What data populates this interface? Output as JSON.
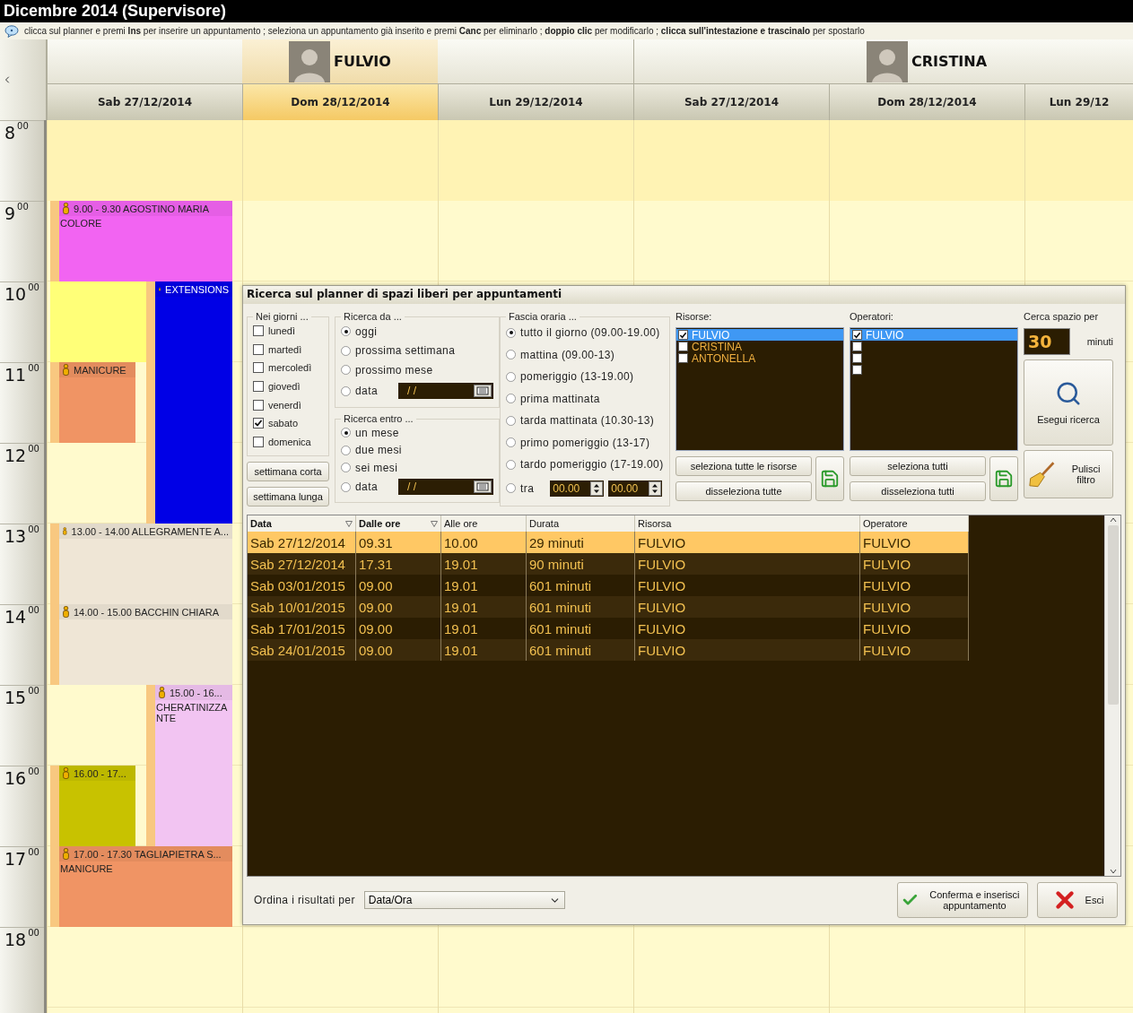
{
  "window": {
    "title": "Dicembre 2014 (Supervisore)"
  },
  "hint": "clicca sul planner e premi **Ins** per inserire un appuntamento ; seleziona un appuntamento già inserito e premi **Canc** per eliminarlo ; **doppio clic** per modificarlo ; **clicca sull'intestazione e trascinalo** per spostarlo",
  "hours": [
    "8$^{00}$",
    "9$^{00}$",
    "10$^{00}$",
    "11$^{00}$",
    "12$^{00}$",
    "13$^{00}$",
    "14$^{00}$",
    "15$^{00}$",
    "16$^{00}$",
    "17$^{00}$",
    "18$^{00}$"
  ],
  "resources": [
    {
      "name": "FULVIO",
      "days": [
        {
          "label": "Sab 27/12/2014",
          "selected": false,
          "appointments": [
            {
              "kind": "appointment",
              "header": "9.00 - 9.30 AGOSTINO  MARIA",
              "body": "COLORE",
              "color": "#f264f2"
            },
            {
              "kind": "highlight",
              "color": "#ffff78"
            },
            {
              "kind": "appointment",
              "header": "EXTENSIONS",
              "color": "#0000e6"
            },
            {
              "kind": "appointment",
              "header": "MANICURE",
              "color": "#f09464"
            },
            {
              "kind": "appointment",
              "header": "13.00 - 14.00 ALLEGRAMENTE  A...",
              "color": "#efe6d6"
            },
            {
              "kind": "appointment",
              "header": "14.00 - 15.00 BACCHIN  CHIARA",
              "color": "#efe6d6"
            },
            {
              "kind": "appointment",
              "header": "15.00 - 16...",
              "body": "CHERATINIZZANTE",
              "color": "#f2c4f2"
            },
            {
              "kind": "appointment",
              "header": "16.00 - 17...",
              "color": "#c8c200"
            },
            {
              "kind": "appointment",
              "header": "17.00 - 17.30 TAGLIAPIETRA  S...",
              "body": "MANICURE",
              "color": "#f09464"
            }
          ]
        },
        {
          "label": "Dom 28/12/2014",
          "selected": true
        },
        {
          "label": "Lun 29/12/2014",
          "selected": false
        }
      ]
    },
    {
      "name": "CRISTINA",
      "days": [
        {
          "label": "Sab 27/12/2014",
          "selected": false
        },
        {
          "label": "Dom 28/12/2014",
          "selected": false
        },
        {
          "label": "Lun 29/12",
          "selected": false
        }
      ]
    }
  ],
  "search_dialog": {
    "title": "Ricerca sul planner di spazi liberi per appuntamenti",
    "days": {
      "legend": "Nei giorni ...",
      "options": [
        {
          "label": "lunedì",
          "checked": false
        },
        {
          "label": "martedì",
          "checked": false
        },
        {
          "label": "mercoledì",
          "checked": false
        },
        {
          "label": "giovedì",
          "checked": false
        },
        {
          "label": "venerdì",
          "checked": false
        },
        {
          "label": "sabato",
          "checked": true
        },
        {
          "label": "domenica",
          "checked": false
        }
      ]
    },
    "days_buttons": [
      "settimana corta",
      "settimana lunga"
    ],
    "search_from": {
      "legend": "Ricerca da ...",
      "options": [
        {
          "kind": "radio",
          "label": "oggi",
          "selected": true
        },
        {
          "kind": "radio",
          "label": "prossima settimana",
          "selected": false
        },
        {
          "kind": "radio",
          "label": "prossimo mese",
          "selected": false
        },
        {
          "kind": "date",
          "label": "data",
          "selected": false,
          "value": "/ /"
        }
      ]
    },
    "search_within": {
      "legend": "Ricerca entro ...",
      "options": [
        {
          "kind": "radio",
          "label": "un mese",
          "selected": true
        },
        {
          "kind": "radio",
          "label": "due mesi",
          "selected": false
        },
        {
          "kind": "radio",
          "label": "sei mesi",
          "selected": false
        },
        {
          "kind": "date",
          "label": "data",
          "selected": false,
          "value": "/ /"
        }
      ]
    },
    "time_range": {
      "legend": "Fascia oraria ...",
      "options": [
        {
          "kind": "radio",
          "label": "tutto il giorno (09.00-19.00)",
          "selected": true
        },
        {
          "kind": "radio",
          "label": "mattina (09.00-13)",
          "selected": false
        },
        {
          "kind": "radio",
          "label": "pomeriggio (13-19.00)",
          "selected": false
        },
        {
          "kind": "radio",
          "label": "prima mattinata",
          "selected": false
        },
        {
          "kind": "radio",
          "label": "tarda mattinata (10.30-13)",
          "selected": false
        },
        {
          "kind": "radio",
          "label": "primo pomeriggio (13-17)",
          "selected": false
        },
        {
          "kind": "radio",
          "label": "tardo pomeriggio (17-19.00)",
          "selected": false
        },
        {
          "kind": "range",
          "label": "tra",
          "selected": false,
          "from": "00.00",
          "to": "00.00"
        }
      ]
    },
    "resources": {
      "label": "Risorse:",
      "items": [
        {
          "name": "FULVIO",
          "checked": true,
          "selected": true
        },
        {
          "name": "CRISTINA",
          "checked": false,
          "selected": false
        },
        {
          "name": "ANTONELLA",
          "checked": false,
          "selected": false
        }
      ],
      "buttons": [
        "seleziona tutte le risorse",
        "disseleziona tutte"
      ]
    },
    "operators": {
      "label": "Operatori:",
      "items": [
        {
          "name": "FULVIO",
          "checked": true,
          "selected": true
        },
        {
          "checked": false,
          "selected": false
        },
        {
          "checked": false,
          "selected": false
        },
        {
          "checked": false,
          "selected": false
        }
      ],
      "buttons": [
        "seleziona tutti",
        "disseleziona tutti"
      ]
    },
    "duration": {
      "label": "Cerca spazio per",
      "value": "30",
      "unit": "minuti"
    },
    "search_button": "Esegui ricerca",
    "clear_button": "Pulisci filtro",
    "results": {
      "columns": [
        {
          "label": "Data",
          "sorted": true
        },
        {
          "label": "Dalle ore",
          "sorted": true
        },
        {
          "label": "Alle ore",
          "sorted": false
        },
        {
          "label": "Durata",
          "sorted": false
        },
        {
          "label": "Risorsa",
          "sorted": false
        },
        {
          "label": "Operatore",
          "sorted": false
        }
      ],
      "rows": [
        {
          "cells": [
            "Sab 27/12/2014",
            "09.31",
            "10.00",
            "29 minuti",
            "FULVIO",
            "FULVIO"
          ],
          "selected": true
        },
        {
          "cells": [
            "Sab 27/12/2014",
            "17.31",
            "19.01",
            "90 minuti",
            "FULVIO",
            "FULVIO"
          ],
          "selected": false
        },
        {
          "cells": [
            "Sab 03/01/2015",
            "09.00",
            "19.01",
            "601 minuti",
            "FULVIO",
            "FULVIO"
          ],
          "selected": false
        },
        {
          "cells": [
            "Sab 10/01/2015",
            "09.00",
            "19.01",
            "601 minuti",
            "FULVIO",
            "FULVIO"
          ],
          "selected": false
        },
        {
          "cells": [
            "Sab 17/01/2015",
            "09.00",
            "19.01",
            "601 minuti",
            "FULVIO",
            "FULVIO"
          ],
          "selected": false
        },
        {
          "cells": [
            "Sab 24/01/2015",
            "09.00",
            "19.01",
            "601 minuti",
            "FULVIO",
            "FULVIO"
          ],
          "selected": false
        }
      ]
    },
    "sort": {
      "label": "Ordina i risultati per",
      "value": "Data/Ora"
    },
    "confirm_button": "Conferma e inserisci appuntamento",
    "exit_button": "Esci"
  }
}
